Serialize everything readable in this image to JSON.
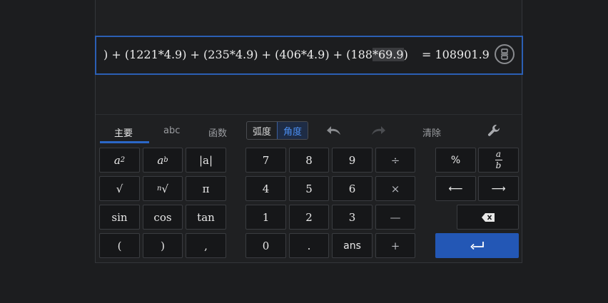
{
  "expression": {
    "text_before": ") + (1221*4.9) + (235*4.9) + (406*4.9) + (",
    "text_mid": "188",
    "text_selected": "*69.9",
    "text_after": ")",
    "result": "= 108901.9"
  },
  "tabs": {
    "main": "主要",
    "abc": "abc",
    "functions": "函数"
  },
  "angle": {
    "radian": "弧度",
    "degree": "角度",
    "selected": "角度"
  },
  "toolbar": {
    "clear": "清除"
  },
  "keys": {
    "abs": "|a|",
    "sqrt": "√",
    "nth_root": "√",
    "nth_root_index": "n",
    "pi": "π",
    "sin": "sin",
    "cos": "cos",
    "tan": "tan",
    "lparen": "(",
    "rparen": ")",
    "comma": ",",
    "seven": "7",
    "eight": "8",
    "nine": "9",
    "divide": "÷",
    "four": "4",
    "five": "5",
    "six": "6",
    "multiply": "×",
    "one": "1",
    "two": "2",
    "three": "3",
    "minus": "—",
    "zero": "0",
    "dot": ".",
    "ans": "ans",
    "plus": "+",
    "percent": "%",
    "left_arrow": "⟵",
    "right_arrow": "⟶",
    "square_base": "a",
    "square_exp": "2",
    "power_base": "a",
    "power_exp": "b",
    "frac_num": "a",
    "frac_den": "b"
  },
  "colors": {
    "accent": "#2b67c8",
    "enter_bg": "#2357b5"
  }
}
